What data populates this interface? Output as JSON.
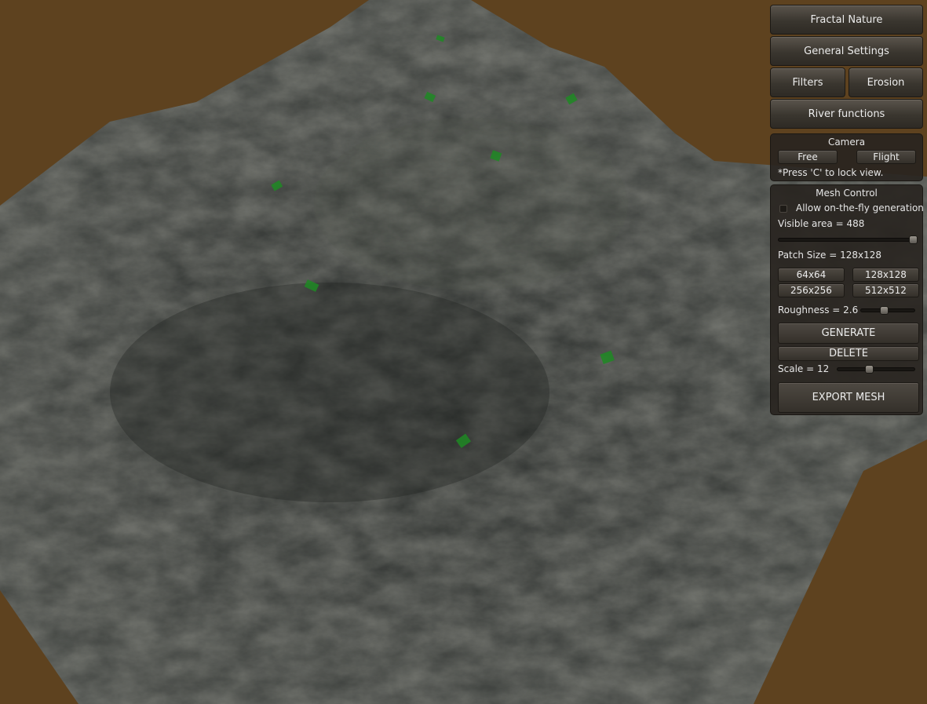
{
  "menu": {
    "fractal_nature": "Fractal Nature",
    "general_settings": "General Settings",
    "filters": "Filters",
    "erosion": "Erosion",
    "river_functions": "River functions"
  },
  "camera": {
    "title": "Camera",
    "free": "Free",
    "flight": "Flight",
    "hint": "*Press 'C' to lock view."
  },
  "mesh_control": {
    "title": "Mesh Control",
    "allow_generation": "Allow on-the-fly generation",
    "allow_generation_checked": false,
    "visible_area_label": "Visible area = 488",
    "visible_area_level": 1.0,
    "patch_size_label": "Patch Size = 128x128",
    "patch_options": [
      "64x64",
      "128x128",
      "256x256",
      "512x512"
    ],
    "roughness_label": "Roughness = 2.6",
    "roughness_level": 0.42,
    "generate": "GENERATE",
    "delete": "DELETE",
    "scale_label": "Scale = 12",
    "scale_level": 0.4,
    "export": "EXPORT MESH"
  },
  "colors": {
    "background": "#5e421f",
    "terrain": "#3f423f",
    "marker": "#1f8a24"
  }
}
